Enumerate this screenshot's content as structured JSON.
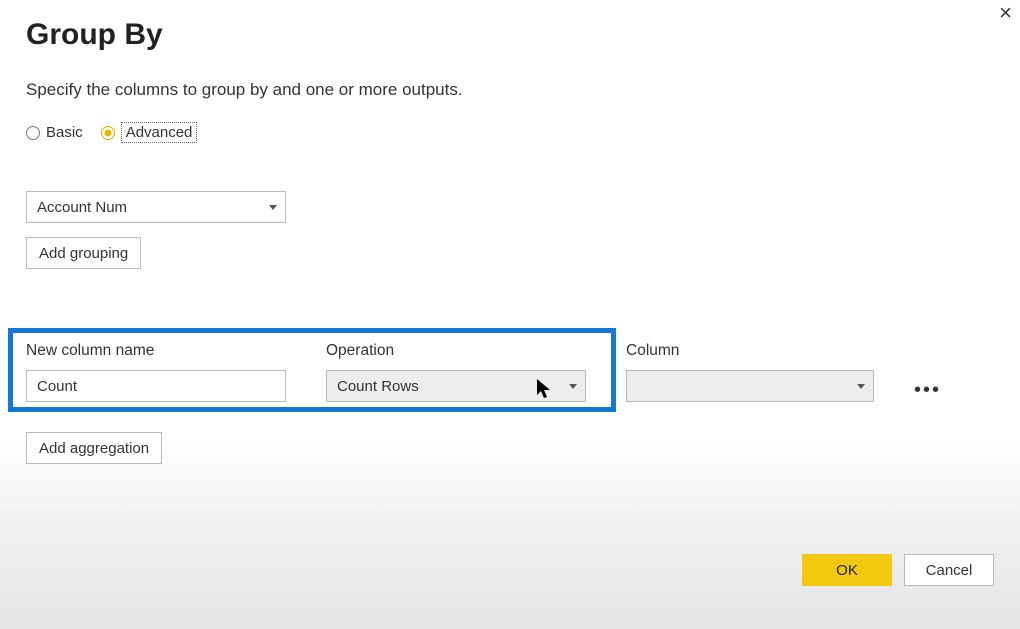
{
  "title": "Group By",
  "subtitle": "Specify the columns to group by and one or more outputs.",
  "radios": {
    "basic": "Basic",
    "advanced": "Advanced",
    "selected": "advanced"
  },
  "group_column": "Account Num",
  "add_grouping_label": "Add grouping",
  "agg_labels": {
    "new_col": "New column name",
    "operation": "Operation",
    "column": "Column"
  },
  "agg": {
    "new_col_value": "Count",
    "operation_value": "Count Rows",
    "column_value": ""
  },
  "add_agg_label": "Add aggregation",
  "footer": {
    "ok": "OK",
    "cancel": "Cancel"
  }
}
